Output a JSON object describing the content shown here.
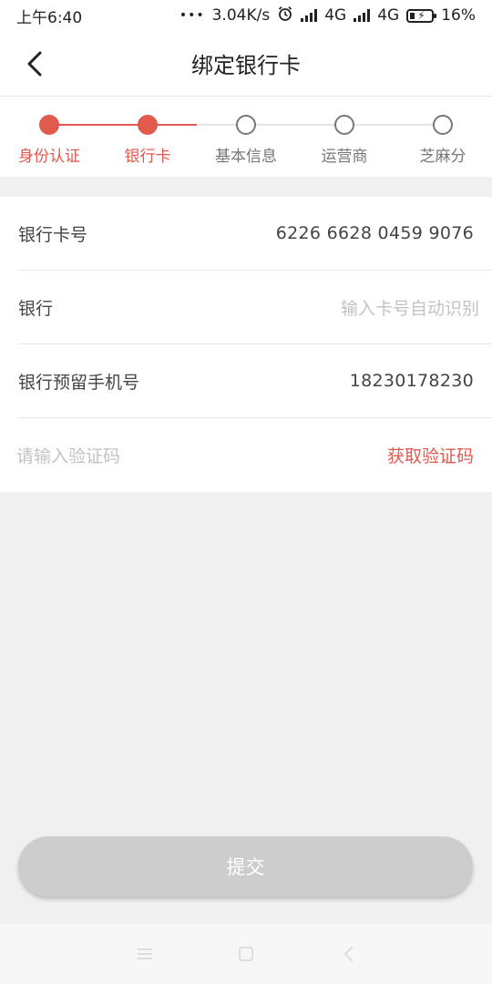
{
  "status_bar": {
    "time": "上午6:40",
    "dots": "•••",
    "net_speed": "3.04K/s",
    "sim1_network": "4G",
    "sim2_network": "4G",
    "battery": "16%"
  },
  "header": {
    "title": "绑定银行卡"
  },
  "steps": [
    {
      "label": "身份认证",
      "done": true
    },
    {
      "label": "银行卡",
      "done": true
    },
    {
      "label": "基本信息",
      "done": false
    },
    {
      "label": "运营商",
      "done": false
    },
    {
      "label": "芝麻分",
      "done": false
    }
  ],
  "form": {
    "card_number_label": "银行卡号",
    "card_number_value": "6226 6628 0459 9076",
    "bank_label": "银行",
    "bank_placeholder": "输入卡号自动识别",
    "phone_label": "银行预留手机号",
    "phone_value": "18230178230",
    "code_placeholder": "请输入验证码",
    "get_code_label": "获取验证码"
  },
  "submit": {
    "label": "提交"
  },
  "colors": {
    "accent": "#e05a4e",
    "disabled_button": "#cdcdcd",
    "page_bg": "#f0f0f0"
  }
}
